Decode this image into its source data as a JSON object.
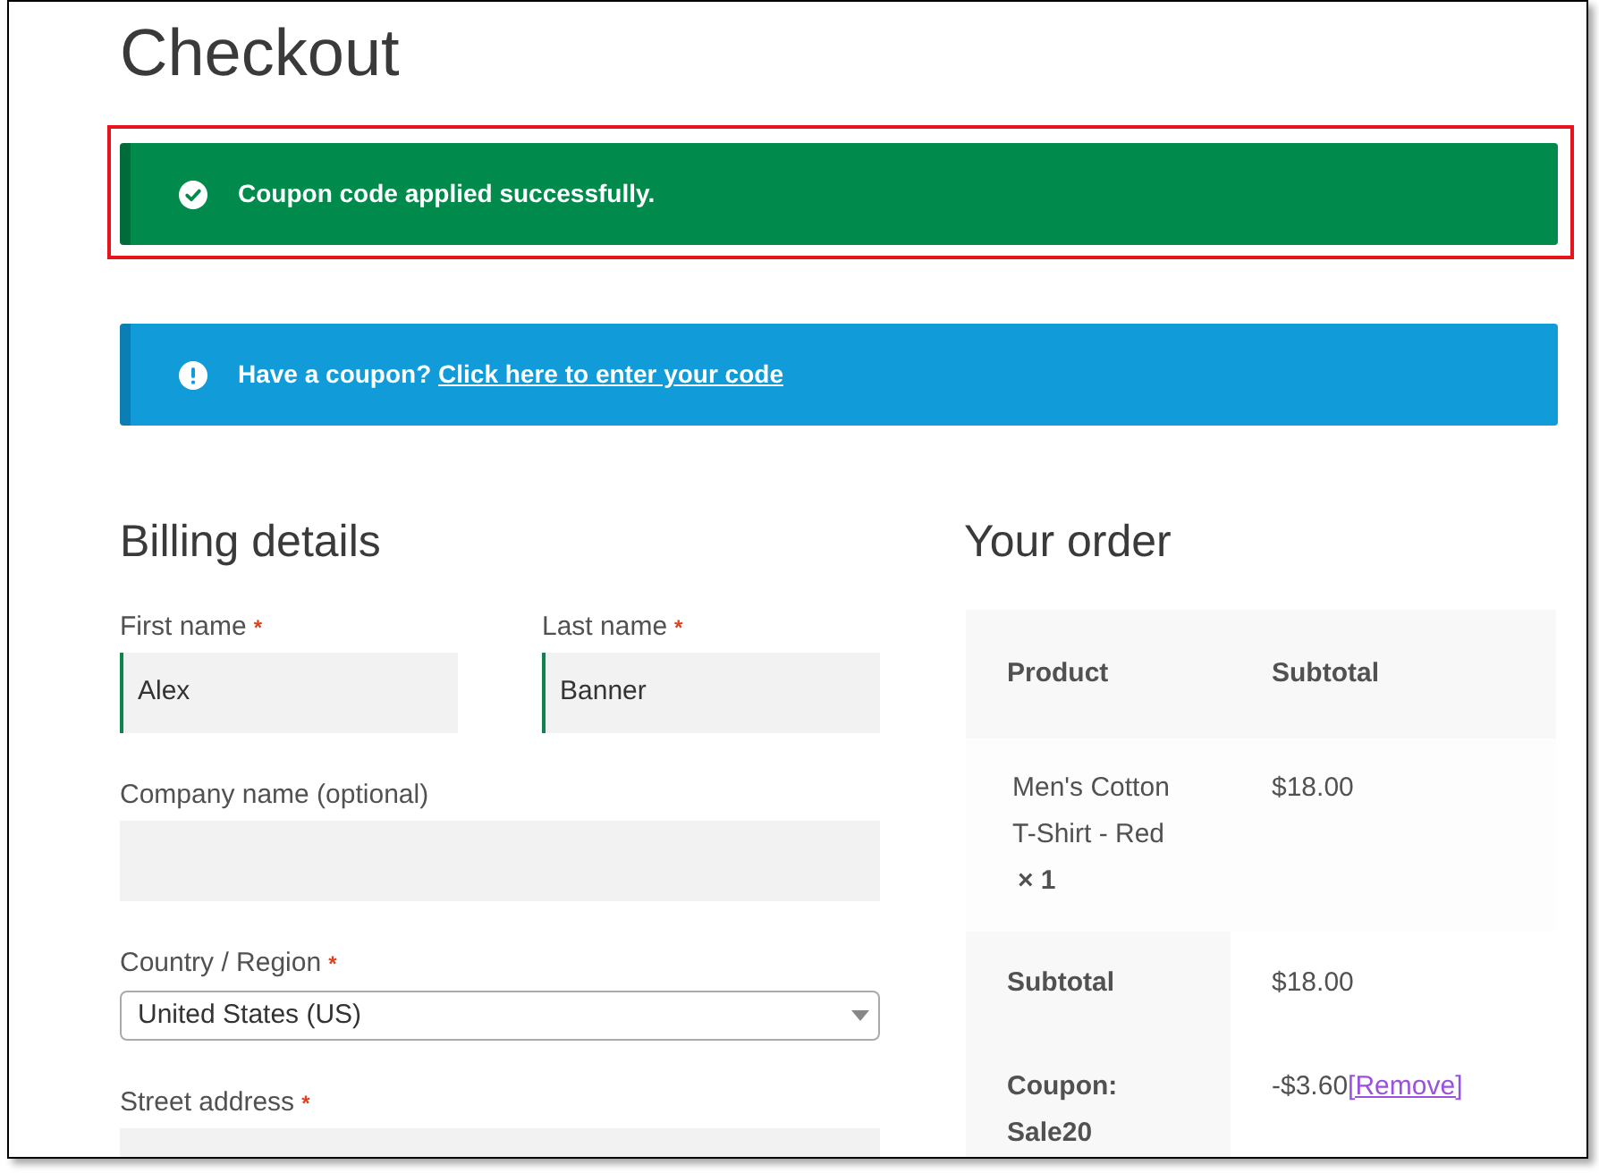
{
  "page": {
    "title": "Checkout"
  },
  "notices": [
    {
      "kind": "success",
      "text": "Coupon code applied successfully.",
      "highlighted": true
    },
    {
      "kind": "info",
      "text": "Have a coupon?",
      "link": "Click here to enter your code",
      "highlighted": false
    }
  ],
  "billing": {
    "title": "Billing details",
    "rows": [
      [
        {
          "kind": "text",
          "label": "First name",
          "required_mark": "*",
          "value": "Alex",
          "validated": true
        },
        {
          "kind": "text",
          "label": "Last name",
          "required_mark": "*",
          "value": "Banner",
          "validated": true
        }
      ],
      [
        {
          "kind": "text",
          "label": "Company name (optional)",
          "validated": false
        }
      ],
      [
        {
          "kind": "select",
          "label": "Country / Region",
          "required_mark": "*",
          "value": "United States (US)"
        }
      ],
      [
        {
          "kind": "text",
          "label": "Street address",
          "required_mark": "*",
          "validated": false
        }
      ]
    ]
  },
  "order": {
    "title": "Your order",
    "columns": [
      "Product",
      "Subtotal"
    ],
    "items": [
      {
        "name": "Men's Cotton T-Shirt - Red",
        "quantity": "× 1",
        "subtotal": "$18.00"
      }
    ],
    "totals": [
      {
        "label": "Subtotal",
        "value": "$18.00"
      },
      {
        "label": "Coupon: Sale20",
        "value": "-$3.60",
        "link": "[Remove]"
      }
    ]
  }
}
